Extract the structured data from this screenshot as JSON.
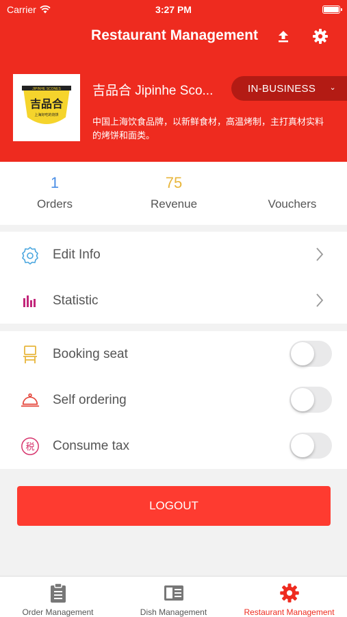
{
  "status_bar": {
    "carrier": "Carrier",
    "time": "3:27 PM"
  },
  "header": {
    "title": "Restaurant Management",
    "upload_icon": "upload-icon",
    "settings_icon": "gear-icon"
  },
  "shop": {
    "name": "吉品合 Jipinhe Sco...",
    "status_label": "IN-BUSINESS",
    "description": "中国上海饮食品牌，以新鲜食材，高温烤制，主打真材实料的烤饼和面类。",
    "logo_text": "吉品合",
    "logo_top_text": "JIPINHE SCONES",
    "logo_sub_text": "上海好吃的烧饼"
  },
  "stats": [
    {
      "value": "1",
      "label": "Orders",
      "color": "#4a8ee5"
    },
    {
      "value": "75",
      "label": "Revenue",
      "color": "#e8b63c"
    },
    {
      "value": "",
      "label": "Vouchers",
      "color": "#555555"
    }
  ],
  "menu": [
    {
      "label": "Edit Info",
      "icon": "gear-outline-icon"
    },
    {
      "label": "Statistic",
      "icon": "bar-chart-icon"
    }
  ],
  "toggles": [
    {
      "label": "Booking seat",
      "icon": "chair-icon",
      "on": false
    },
    {
      "label": "Self ordering",
      "icon": "cloche-icon",
      "on": false
    },
    {
      "label": "Consume tax",
      "icon": "tax-icon",
      "icon_text": "税",
      "on": false
    }
  ],
  "logout_label": "LOGOUT",
  "tabs": [
    {
      "label": "Order Management",
      "icon": "clipboard-icon",
      "active": false
    },
    {
      "label": "Dish Management",
      "icon": "menu-book-icon",
      "active": false
    },
    {
      "label": "Restaurant Management",
      "icon": "gear-icon",
      "active": true
    }
  ],
  "colors": {
    "brand": "#ee2b1f",
    "logout": "#fe3b30",
    "business_pill": "#b31b14"
  }
}
